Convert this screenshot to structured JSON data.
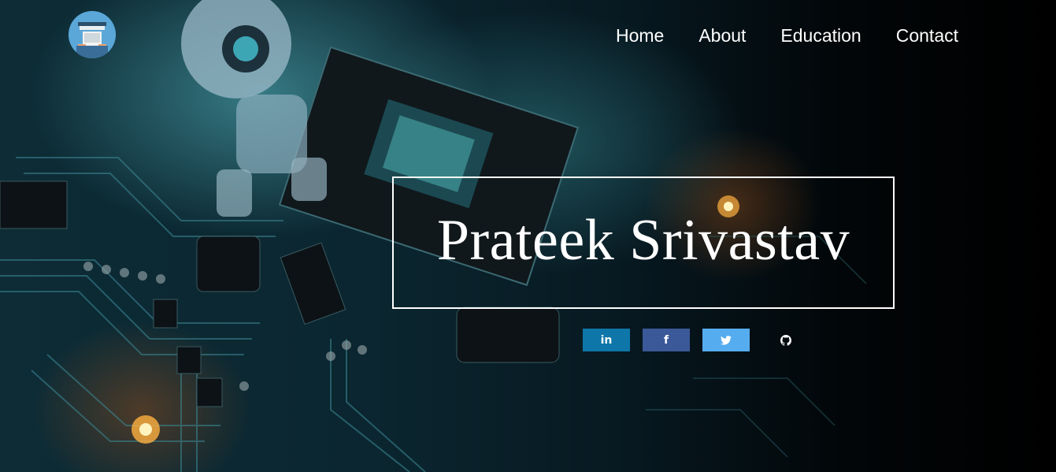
{
  "nav": {
    "items": [
      {
        "label": "Home"
      },
      {
        "label": "About"
      },
      {
        "label": "Education"
      },
      {
        "label": "Contact"
      }
    ]
  },
  "hero": {
    "name": "Prateek Srivastav"
  },
  "social": [
    {
      "name": "linkedin",
      "glyph": "in",
      "color": "#0e76a8"
    },
    {
      "name": "facebook",
      "glyph": "f",
      "color": "#3b5998"
    },
    {
      "name": "twitter",
      "glyph": "🐦",
      "color": "#55acee"
    },
    {
      "name": "github",
      "glyph": "●",
      "color": "transparent"
    }
  ]
}
